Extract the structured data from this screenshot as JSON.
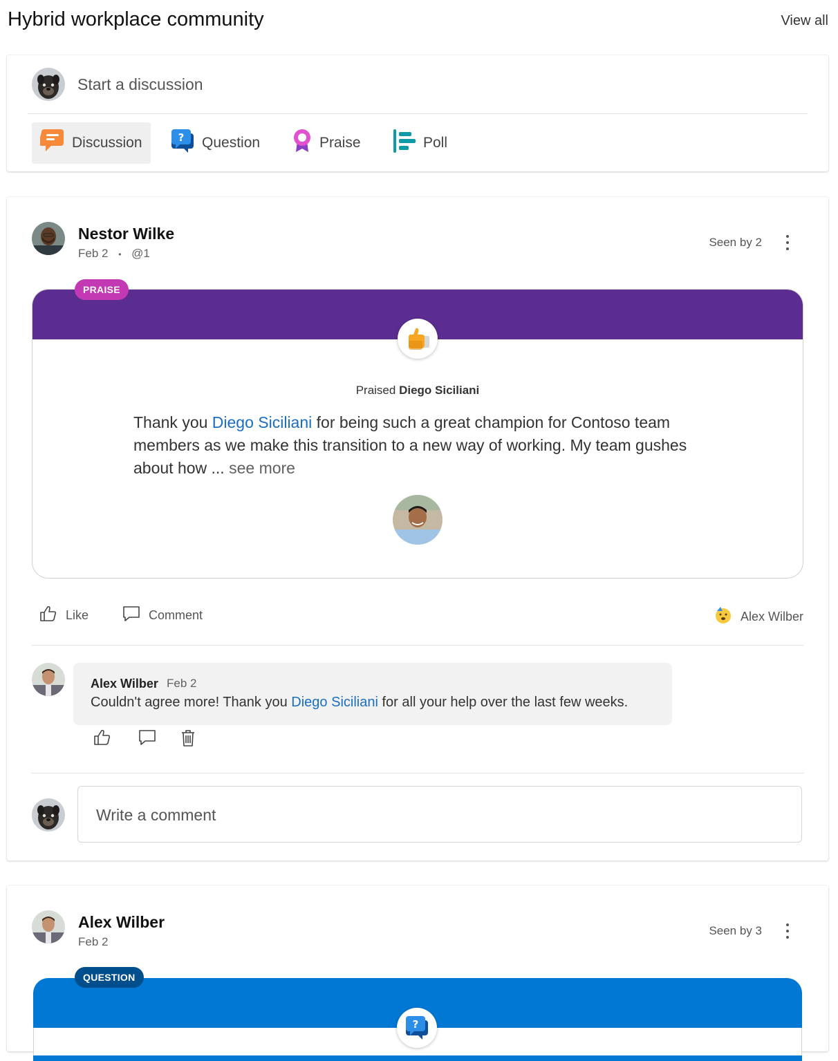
{
  "header": {
    "title": "Hybrid workplace community",
    "view_all": "View all"
  },
  "composer": {
    "placeholder": "Start a discussion",
    "types": [
      {
        "label": "Discussion",
        "icon": "discussion-icon",
        "color": "#f7893b"
      },
      {
        "label": "Question",
        "icon": "question-icon",
        "color": "#0f6cbd"
      },
      {
        "label": "Praise",
        "icon": "praise-icon",
        "color": "#c239b3"
      },
      {
        "label": "Poll",
        "icon": "poll-icon",
        "color": "#0e9aa7"
      }
    ]
  },
  "posts": [
    {
      "author": "Nestor Wilke",
      "date": "Feb 2",
      "separator": "•",
      "mention": "@1",
      "seen": "Seen by 2",
      "tag": "PRAISE",
      "tag_color": "#c239b3",
      "banner_color": "#5c2d91",
      "praised_prefix": "Praised",
      "praised_name": "Diego Siciliani",
      "message": {
        "part1": "Thank you ",
        "link": "Diego Siciliani",
        "part2": " for being such a great champion for Contoso team members as we make this transition to a new way of working. My team gushes about how ... ",
        "see_more": "see more"
      },
      "actions": {
        "like": "Like",
        "comment": "Comment"
      },
      "reactor": "Alex Wilber",
      "comments": [
        {
          "author": "Alex Wilber",
          "date": "Feb 2",
          "text_part1": "Couldn't agree more! Thank you ",
          "link": "Diego Siciliani",
          "text_part2": " for all your help over the last few weeks."
        }
      ],
      "comment_placeholder": "Write a comment"
    },
    {
      "author": "Alex Wilber",
      "date": "Feb 2",
      "seen": "Seen by 3",
      "tag": "QUESTION",
      "tag_color": "#004e8c",
      "banner_color": "#0078d4"
    }
  ]
}
